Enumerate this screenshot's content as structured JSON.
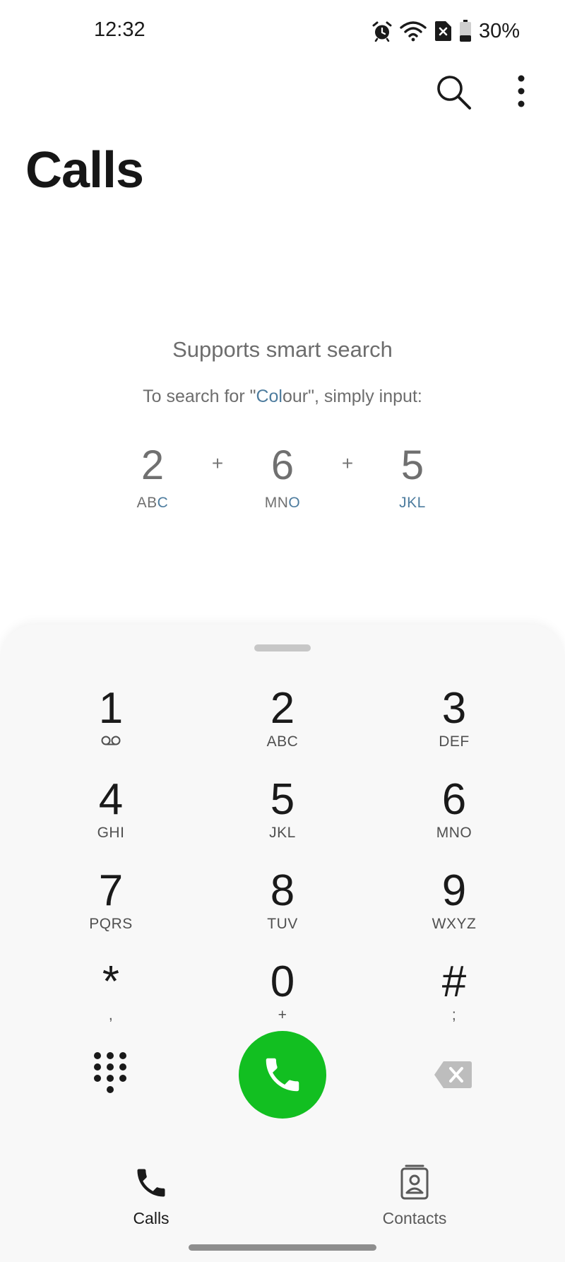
{
  "status_bar": {
    "time": "12:32",
    "battery": "30%"
  },
  "header": {
    "title": "Calls"
  },
  "smart_search": {
    "title": "Supports smart search",
    "subtitle_prefix": "To search for \"",
    "subtitle_highlight": "Col",
    "subtitle_rest": "our",
    "subtitle_suffix": "\", simply input:",
    "example": [
      {
        "digit": "2",
        "letters_plain": "AB",
        "letters_highlight": "C"
      },
      {
        "digit": "6",
        "letters_plain": "MN",
        "letters_highlight": "O"
      },
      {
        "digit": "5",
        "letters_plain": "",
        "letters_highlight": "JKL"
      }
    ],
    "plus": "+"
  },
  "keypad": {
    "keys": [
      {
        "digit": "1",
        "sub": ""
      },
      {
        "digit": "2",
        "sub": "ABC"
      },
      {
        "digit": "3",
        "sub": "DEF"
      },
      {
        "digit": "4",
        "sub": "GHI"
      },
      {
        "digit": "5",
        "sub": "JKL"
      },
      {
        "digit": "6",
        "sub": "MNO"
      },
      {
        "digit": "7",
        "sub": "PQRS"
      },
      {
        "digit": "8",
        "sub": "TUV"
      },
      {
        "digit": "9",
        "sub": "WXYZ"
      },
      {
        "digit": "*",
        "sub": ","
      },
      {
        "digit": "0",
        "sub": "+"
      },
      {
        "digit": "#",
        "sub": ";"
      }
    ]
  },
  "colors": {
    "call_green": "#12bf21",
    "highlight_blue": "#4d7c9e"
  },
  "bottom_nav": {
    "calls_label": "Calls",
    "contacts_label": "Contacts"
  }
}
